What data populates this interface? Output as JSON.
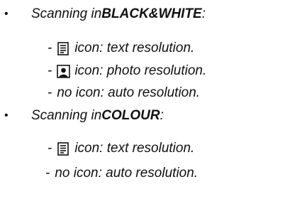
{
  "sections": [
    {
      "bullet": "•",
      "prefix": "Scanning in ",
      "mode": "BLACK&WHITE",
      "suffix": ":",
      "items": [
        {
          "dash": "-",
          "icon": "text-document-icon",
          "text": "icon: text resolution."
        },
        {
          "dash": "-",
          "icon": "photo-portrait-icon",
          "text": "icon: photo resolution."
        },
        {
          "dash": "-",
          "icon": "",
          "text": "no icon: auto resolution."
        }
      ]
    },
    {
      "bullet": "•",
      "prefix": "Scanning in ",
      "mode": "COLOUR",
      "suffix": ":",
      "items": [
        {
          "dash": "-",
          "icon": "text-document-icon",
          "text": "icon: text resolution."
        },
        {
          "dash": "-",
          "icon": "",
          "text": "no icon: auto resolution."
        }
      ]
    }
  ]
}
